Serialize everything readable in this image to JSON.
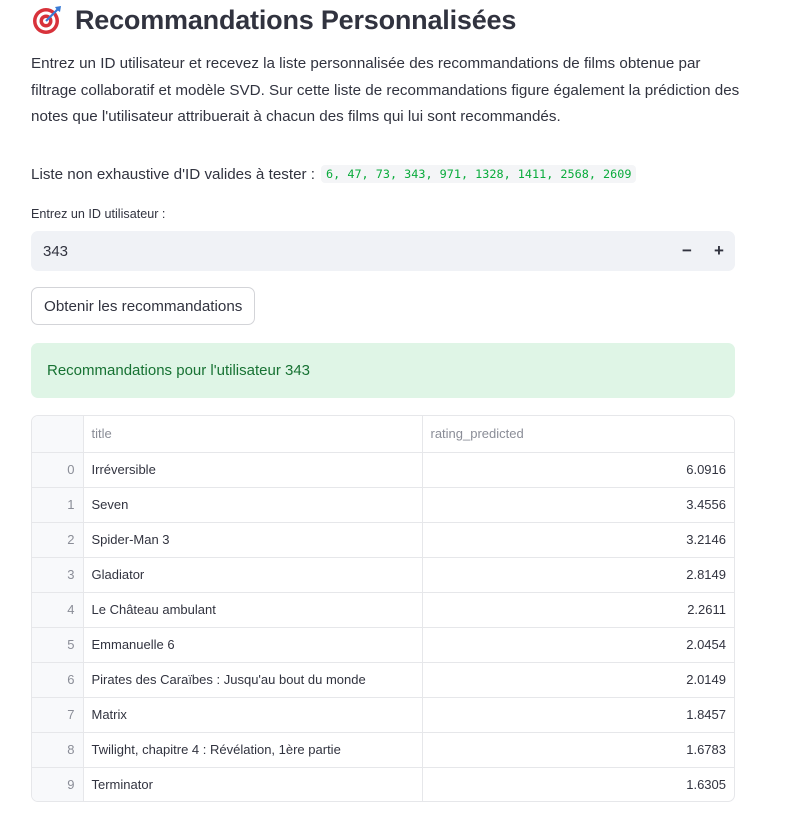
{
  "header": {
    "icon": "target-icon",
    "title": "Recommandations Personnalisées"
  },
  "intro": {
    "text": "Entrez un ID utilisateur et recevez la liste personnalisée des recommandations de films obtenue par filtrage collaboratif et modèle SVD. Sur cette liste de recommandations figure également la prédiction des notes que l'utilisateur attribuerait à chacun des films qui lui sont recommandés."
  },
  "valid_ids": {
    "label": "Liste non exhaustive d'ID valides à tester :",
    "ids": "6, 47, 73, 343, 971, 1328, 1411, 2568, 2609"
  },
  "user_input": {
    "label": "Entrez un ID utilisateur :",
    "value": "343",
    "minus": "−",
    "plus": "+"
  },
  "submit_button": {
    "label": "Obtenir les recommandations"
  },
  "result": {
    "message": "Recommandations pour l'utilisateur 343"
  },
  "colors": {
    "success_bg": "#dff5e6",
    "success_text": "#177233",
    "code_text": "#09ab3b"
  },
  "table": {
    "columns": [
      "",
      "title",
      "rating_predicted"
    ],
    "rows": [
      {
        "index": "0",
        "title": "Irréversible",
        "rating": "6.0916"
      },
      {
        "index": "1",
        "title": "Seven",
        "rating": "3.4556"
      },
      {
        "index": "2",
        "title": "Spider-Man 3",
        "rating": "3.2146"
      },
      {
        "index": "3",
        "title": "Gladiator",
        "rating": "2.8149"
      },
      {
        "index": "4",
        "title": "Le Château ambulant",
        "rating": "2.2611"
      },
      {
        "index": "5",
        "title": "Emmanuelle 6",
        "rating": "2.0454"
      },
      {
        "index": "6",
        "title": "Pirates des Caraïbes : Jusqu'au bout du monde",
        "rating": "2.0149"
      },
      {
        "index": "7",
        "title": "Matrix",
        "rating": "1.8457"
      },
      {
        "index": "8",
        "title": "Twilight, chapitre 4 : Révélation, 1ère partie",
        "rating": "1.6783"
      },
      {
        "index": "9",
        "title": "Terminator",
        "rating": "1.6305"
      }
    ]
  }
}
